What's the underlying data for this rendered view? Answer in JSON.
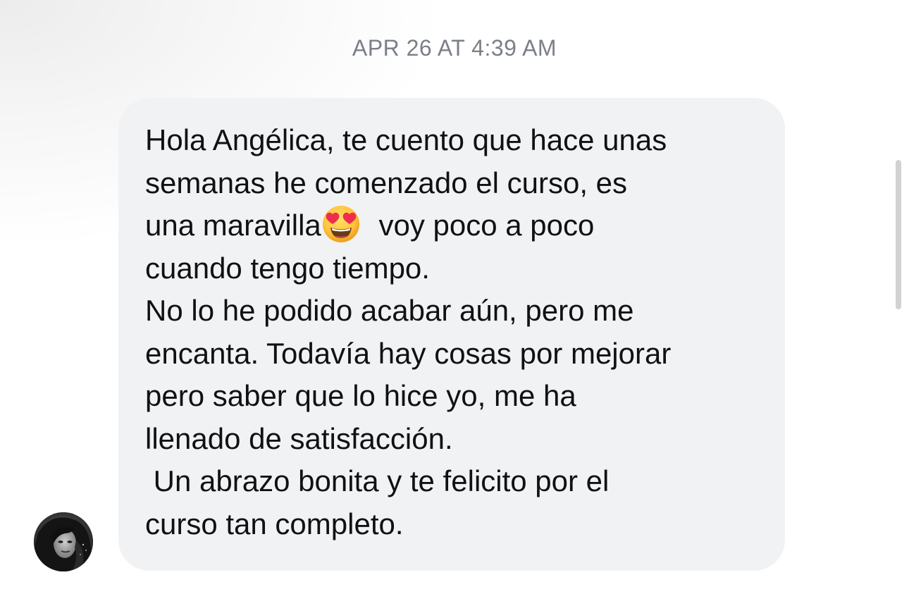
{
  "conversation": {
    "timestamp": "APR 26 AT 4:39 AM",
    "message": {
      "line1": "Hola Angélica, te cuento que hace unas",
      "line2": "semanas he comenzado el curso, es",
      "line3a": "una maravilla",
      "emoji": "smiling-face-with-heart-eyes",
      "line3b": " voy poco a poco",
      "line4": "cuando tengo tiempo.",
      "line5": "No lo he podido acabar aún, pero me",
      "line6": "encanta. Todavía hay cosas por mejorar",
      "line7": "pero saber que lo hice yo, me ha",
      "line8": "llenado de satisfacción.",
      "line9": " Un abrazo bonita y te felicito por el",
      "line10": "curso tan completo."
    },
    "bubble_color": "#f1f2f4",
    "timestamp_color": "#7b7f87"
  }
}
